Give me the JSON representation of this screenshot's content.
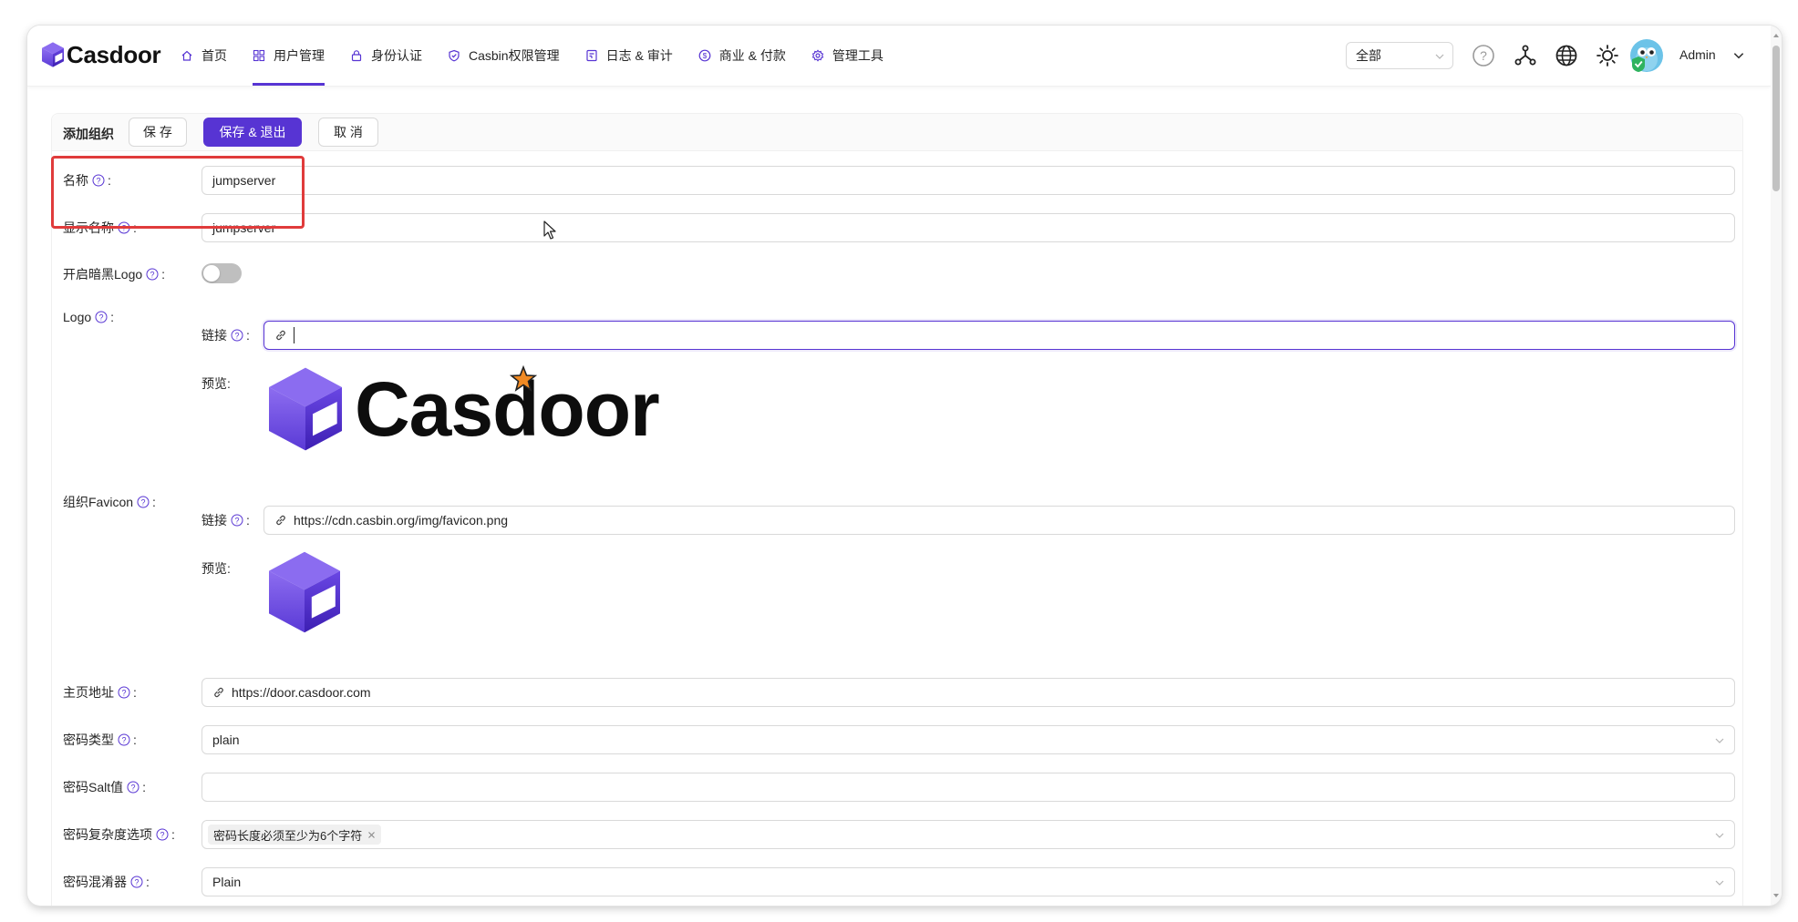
{
  "brand": {
    "name": "Casdoor"
  },
  "nav": {
    "items": [
      {
        "label": "首页",
        "icon": "home-icon"
      },
      {
        "label": "用户管理",
        "icon": "grid-icon",
        "active": true
      },
      {
        "label": "身份认证",
        "icon": "lock-icon"
      },
      {
        "label": "Casbin权限管理",
        "icon": "shield-check-icon"
      },
      {
        "label": "日志 & 审计",
        "icon": "log-icon"
      },
      {
        "label": "商业 & 付款",
        "icon": "dollar-icon"
      },
      {
        "label": "管理工具",
        "icon": "gear-icon"
      }
    ],
    "accent": "#5734d3"
  },
  "header": {
    "org_selector": "全部",
    "user_name": "Admin",
    "icons": [
      "help-circle-icon",
      "network-icon",
      "globe-icon",
      "sun-icon",
      "avatar"
    ]
  },
  "card": {
    "title": "添加组织",
    "save": "保 存",
    "save_exit": "保存 & 退出",
    "cancel": "取 消"
  },
  "form": {
    "name": {
      "label": "名称",
      "value": "jumpserver"
    },
    "display_name": {
      "label": "显示名称",
      "value": "jumpserver"
    },
    "dark_logo": {
      "label": "开启暗黑Logo",
      "enabled": false
    },
    "logo": {
      "label": "Logo",
      "link_label": "链接",
      "link_value": "",
      "preview_label": "预览:",
      "preview_text": "Casdoor"
    },
    "favicon": {
      "label": "组织Favicon",
      "link_label": "链接",
      "link_value": "https://cdn.casbin.org/img/favicon.png",
      "preview_label": "预览:"
    },
    "homepage": {
      "label": "主页地址",
      "value": "https://door.casdoor.com"
    },
    "password_type": {
      "label": "密码类型",
      "value": "plain"
    },
    "password_salt": {
      "label": "密码Salt值",
      "value": ""
    },
    "password_options": {
      "label": "密码复杂度选项",
      "tag": "密码长度必须至少为6个字符"
    },
    "password_obfuscator": {
      "label": "密码混淆器",
      "value": "Plain"
    }
  },
  "colors": {
    "highlight_box": "#e03b3b",
    "primary": "#5734d3"
  }
}
